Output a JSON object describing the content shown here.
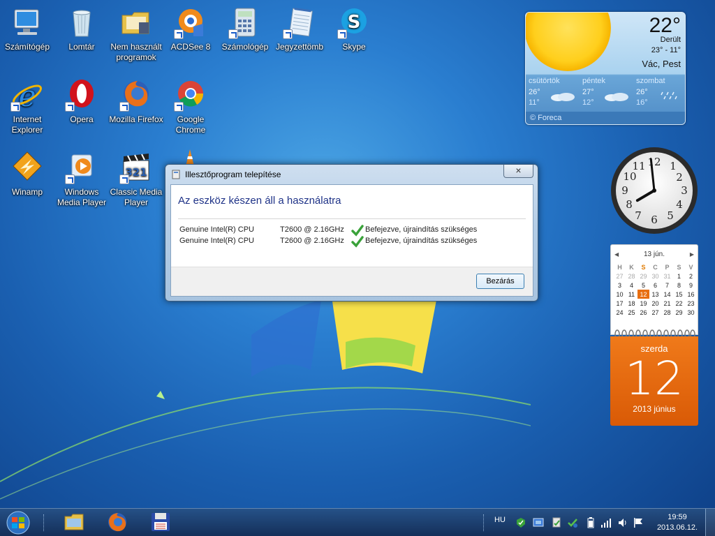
{
  "desktop": {
    "icons": [
      {
        "label": "Számítógép",
        "icon": "computer-icon"
      },
      {
        "label": "Lomtár",
        "icon": "recycle-bin-icon"
      },
      {
        "label": "Nem használt programok",
        "icon": "folder-icon"
      },
      {
        "label": "ACDSee 8",
        "icon": "acdsee-icon"
      },
      {
        "label": "Számológép",
        "icon": "calculator-icon"
      },
      {
        "label": "Jegyzettömb",
        "icon": "notepad-icon"
      },
      {
        "label": "Skype",
        "icon": "skype-icon"
      },
      {
        "label": "Internet Explorer",
        "icon": "internet-explorer-icon"
      },
      {
        "label": "Opera",
        "icon": "opera-icon"
      },
      {
        "label": "Mozilla Firefox",
        "icon": "firefox-icon"
      },
      {
        "label": "Google Chrome",
        "icon": "chrome-icon"
      },
      {
        "label": "Winamp",
        "icon": "winamp-icon"
      },
      {
        "label": "Windows Media Player",
        "icon": "windows-media-player-icon"
      },
      {
        "label": "Classic Media Player",
        "icon": "classic-media-player-icon"
      }
    ]
  },
  "weather": {
    "temp": "22°",
    "condition": "Derült",
    "range": "23° - 11°",
    "city": "Vác, Pest",
    "forecast": [
      {
        "day": "csütörtök",
        "high": "26°",
        "low": "11°",
        "icon": "cloud-icon"
      },
      {
        "day": "péntek",
        "high": "27°",
        "low": "12°",
        "icon": "cloud-icon"
      },
      {
        "day": "szombat",
        "high": "26°",
        "low": "16°",
        "icon": "rain-icon"
      }
    ],
    "source": "© Foreca"
  },
  "clock": {
    "hour": 7,
    "minute": 59
  },
  "calendar": {
    "month_label": "13 jún.",
    "prev": "◀",
    "next": "▶",
    "headers": [
      "H",
      "K",
      "S",
      "C",
      "P",
      "S",
      "V"
    ],
    "weeks": [
      [
        "27",
        "28",
        "29",
        "30",
        "31",
        "1",
        "2"
      ],
      [
        "3",
        "4",
        "5",
        "6",
        "7",
        "8",
        "9"
      ],
      [
        "10",
        "11",
        "12",
        "13",
        "14",
        "15",
        "16"
      ],
      [
        "17",
        "18",
        "19",
        "20",
        "21",
        "22",
        "23"
      ],
      [
        "24",
        "25",
        "26",
        "27",
        "28",
        "29",
        "30"
      ]
    ],
    "today": "12",
    "weekday": "szerda",
    "day": "12",
    "year_month": "2013 június"
  },
  "dialog": {
    "title": "Illesztőprogram telepítése",
    "close_label": "×",
    "heading": "Az eszköz készen áll a használatra",
    "rows": [
      {
        "device": "Genuine Intel(R) CPU",
        "model": "T2600  @ 2.16GHz",
        "status": "Befejezve, újraindítás szükséges"
      },
      {
        "device": "Genuine Intel(R) CPU",
        "model": "T2600  @ 2.16GHz",
        "status": "Befejezve, újraindítás szükséges"
      }
    ],
    "close_button": "Bezárás"
  },
  "taskbar": {
    "pinned": [
      {
        "name": "Windows Explorer",
        "icon": "explorer-folder-icon"
      },
      {
        "name": "Mozilla Firefox",
        "icon": "firefox-icon"
      },
      {
        "name": "Save",
        "icon": "floppy-disk-icon"
      }
    ],
    "language": "HU",
    "time": "19:59",
    "date": "2013.06.12."
  },
  "colors": {
    "dialog_heading": "#1e3287",
    "calendar_accent": "#e86e10",
    "taskbar": "#1c3d6e"
  }
}
